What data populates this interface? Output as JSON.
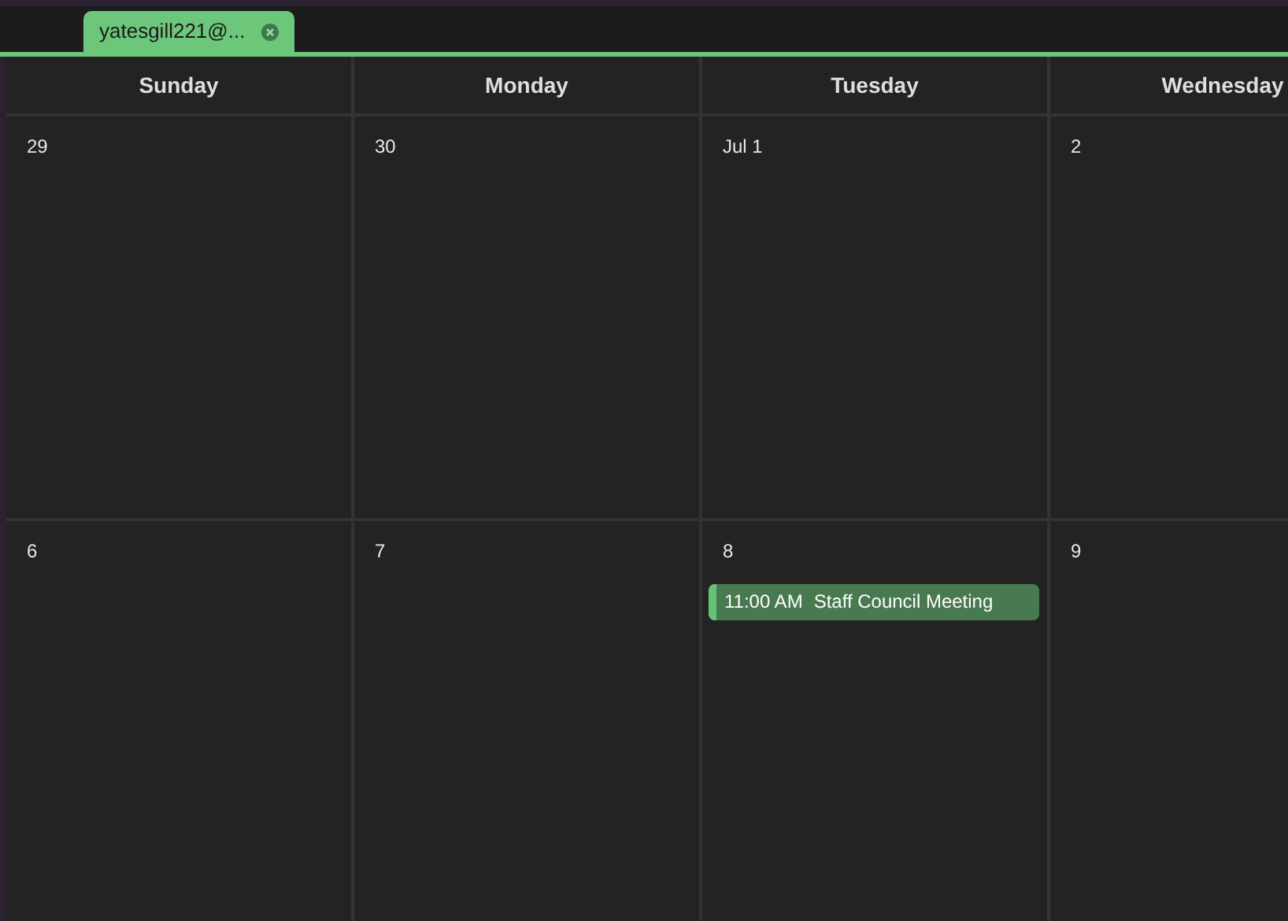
{
  "tabs": [
    {
      "label": "yatesgill221@...",
      "selected": true
    }
  ],
  "days": [
    "Sunday",
    "Monday",
    "Tuesday",
    "Wednesday"
  ],
  "weeks": [
    {
      "cells": [
        {
          "date": "29"
        },
        {
          "date": "30"
        },
        {
          "date": "Jul 1"
        },
        {
          "date": "2"
        }
      ]
    },
    {
      "cells": [
        {
          "date": "6"
        },
        {
          "date": "7"
        },
        {
          "date": "8",
          "events": [
            {
              "time": "11:00 AM",
              "title": "Staff Council Meeting",
              "color": "#63c474"
            }
          ]
        },
        {
          "date": "9"
        }
      ]
    }
  ]
}
